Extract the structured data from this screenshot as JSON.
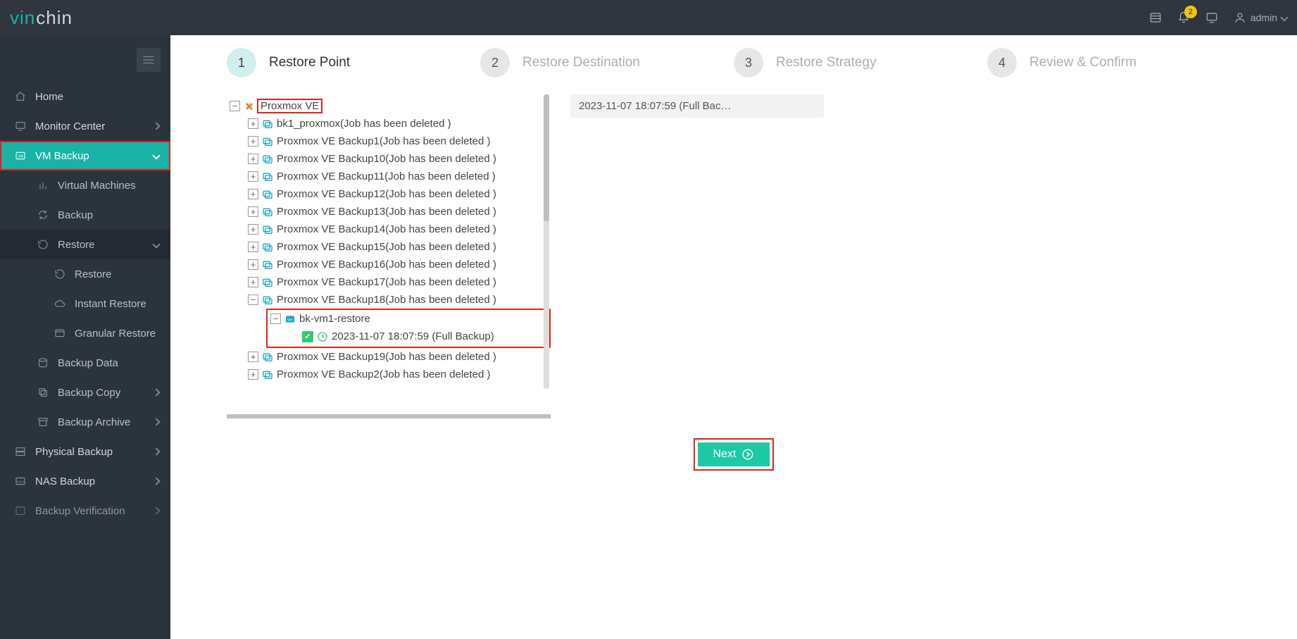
{
  "colors": {
    "brand_accent": "#18b3a6",
    "sidebar_bg": "#2b333c",
    "topbar_bg": "#2f3640",
    "highlight_red": "#d9261c",
    "next_green": "#1dc9a4",
    "badge": "#f1c40f"
  },
  "topbar": {
    "brand_left": "vin",
    "brand_right": "chin",
    "notification_count": "2",
    "user_label": "admin"
  },
  "sidebar": {
    "items": [
      {
        "label": "Home",
        "icon": "home-icon",
        "expandable": false
      },
      {
        "label": "Monitor Center",
        "icon": "monitor-icon",
        "expandable": true
      },
      {
        "label": "VM Backup",
        "icon": "vm-icon",
        "expandable": true,
        "active": true,
        "open": true,
        "children": [
          {
            "label": "Virtual Machines",
            "icon": "bar-icon"
          },
          {
            "label": "Backup",
            "icon": "refresh-icon"
          },
          {
            "label": "Restore",
            "icon": "history-icon",
            "open": true,
            "children": [
              {
                "label": "Restore",
                "icon": "history-icon"
              },
              {
                "label": "Instant Restore",
                "icon": "cloud-icon"
              },
              {
                "label": "Granular Restore",
                "icon": "browser-icon"
              }
            ]
          },
          {
            "label": "Backup Data",
            "icon": "db-icon"
          },
          {
            "label": "Backup Copy",
            "icon": "copy-icon",
            "expandable": true
          },
          {
            "label": "Backup Archive",
            "icon": "archive-icon",
            "expandable": true
          }
        ]
      },
      {
        "label": "Physical Backup",
        "icon": "server-icon",
        "expandable": true
      },
      {
        "label": "NAS Backup",
        "icon": "nas-icon",
        "expandable": true
      },
      {
        "label": "Backup Verification",
        "icon": "verify-icon",
        "expandable": true
      }
    ]
  },
  "wizard": {
    "steps": [
      {
        "num": "1",
        "label": "Restore Point",
        "active": true
      },
      {
        "num": "2",
        "label": "Restore Destination",
        "active": false
      },
      {
        "num": "3",
        "label": "Restore Strategy",
        "active": false
      },
      {
        "num": "4",
        "label": "Review & Confirm",
        "active": false
      }
    ],
    "next_label": "Next"
  },
  "tree": {
    "root_label": "Proxmox VE",
    "jobs": [
      "bk1_proxmox(Job has been deleted )",
      "Proxmox VE Backup1(Job has been deleted )",
      "Proxmox VE Backup10(Job has been deleted )",
      "Proxmox VE Backup11(Job has been deleted )",
      "Proxmox VE Backup12(Job has been deleted )",
      "Proxmox VE Backup13(Job has been deleted )",
      "Proxmox VE Backup14(Job has been deleted )",
      "Proxmox VE Backup15(Job has been deleted )",
      "Proxmox VE Backup16(Job has been deleted )",
      "Proxmox VE Backup17(Job has been deleted )"
    ],
    "expanded_job_label": "Proxmox VE Backup18(Job has been deleted )",
    "vm_label": "bk-vm1-restore",
    "restore_point_label": "2023-11-07 18:07:59 (Full  Backup)",
    "after_jobs": [
      "Proxmox VE Backup19(Job has been deleted )",
      "Proxmox VE Backup2(Job has been deleted )"
    ]
  },
  "selected": {
    "item_label": "2023-11-07 18:07:59 (Full Bac…"
  }
}
